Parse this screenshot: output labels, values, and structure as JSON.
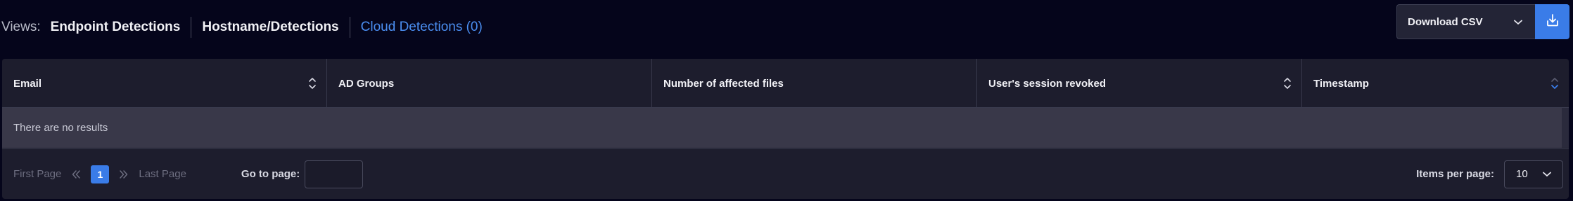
{
  "views": {
    "label": "Views:",
    "tabs": [
      {
        "label": "Endpoint Detections",
        "active": false
      },
      {
        "label": "Hostname/Detections",
        "active": false
      },
      {
        "label": "Cloud Detections (0)",
        "active": true
      }
    ]
  },
  "download": {
    "label": "Download CSV",
    "dropdown_icon": "chevron-down-icon",
    "button_icon": "download-icon"
  },
  "table": {
    "columns": [
      {
        "label": "Email",
        "sortable": true,
        "sort": "none"
      },
      {
        "label": "AD Groups",
        "sortable": false
      },
      {
        "label": "Number of affected files",
        "sortable": false
      },
      {
        "label": "User's session revoked",
        "sortable": true,
        "sort": "none"
      },
      {
        "label": "Timestamp",
        "sortable": true,
        "sort": "desc"
      }
    ],
    "empty_text": "There are no results"
  },
  "pagination": {
    "first_label": "First Page",
    "current_page": "1",
    "last_label": "Last Page",
    "goto_label": "Go to page:",
    "goto_value": "",
    "items_per_page_label": "Items per page:",
    "items_per_page_value": "10"
  },
  "colors": {
    "background": "#05051b",
    "accent": "#3a7ce8",
    "active_tab": "#4b8ff2",
    "table_bg": "#1d1d2d",
    "empty_row_bg": "#393849"
  }
}
